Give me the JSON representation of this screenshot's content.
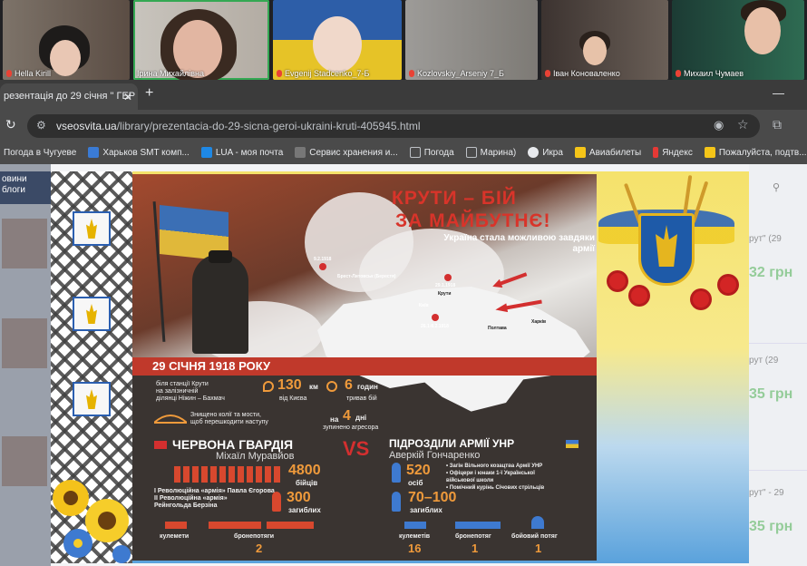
{
  "call": {
    "participants": [
      {
        "name": "Hella Kirill"
      },
      {
        "name": "Ірина Михайлівна"
      },
      {
        "name": "Evgenij Stadcenko_7-Б"
      },
      {
        "name": "Kozlovskiy_Arseniy 7_Б"
      },
      {
        "name": "Іван Коноваленко"
      },
      {
        "name": "Михаил Чумаев"
      }
    ]
  },
  "browser": {
    "tab_title": "резентація до 29 січня \" ГЕР",
    "url_host": "vseosvita.ua",
    "url_path": "/library/prezentacia-do-29-sicna-geroi-ukraini-kruti-405945.html",
    "bookmarks": [
      {
        "label": "Погода в Чугуеве",
        "icon": "weather-icon",
        "color": "#4a90e2"
      },
      {
        "label": "Харьков SMT комп...",
        "icon": "smt-icon",
        "color": "#3a7bd5"
      },
      {
        "label": "LUA - моя почта",
        "icon": "mail-icon",
        "color": "#1e88e5"
      },
      {
        "label": "Сервис хранения и...",
        "icon": "storage-icon",
        "color": "#777777"
      },
      {
        "label": "Погода",
        "icon": "folder-icon",
        "color": "#bdc1c6"
      },
      {
        "label": "Марина)",
        "icon": "folder-icon",
        "color": "#bdc1c6"
      },
      {
        "label": "Икра",
        "icon": "globe-icon",
        "color": "#e8eaed"
      },
      {
        "label": "Авиабилеты",
        "icon": "plane-icon",
        "color": "#f5c518"
      },
      {
        "label": "Яндекс",
        "icon": "yandex-icon",
        "color": "#e53935"
      },
      {
        "label": "Пожалуйста, подтв...",
        "icon": "confirm-icon",
        "color": "#f5c518"
      }
    ]
  },
  "page": {
    "left_header": "овини\nблоги",
    "right_items": [
      {
        "title": "рут\" (29",
        "price": "32 грн"
      },
      {
        "title": "рут (29",
        "price": "35 грн"
      },
      {
        "title": "рут\" - 29",
        "price": "35 грн"
      }
    ]
  },
  "slide": {
    "title_line1": "КРУТИ – БІЙ",
    "title_line2": "ЗА МАЙБУТНЄ!",
    "subtitle": "Україна стала можливою завдяки армії",
    "map_labels": {
      "brest": "Брест-Литовськ (Берестя)",
      "date1": "9.2.1918",
      "kruty": "Крути",
      "kyiv": "Київ",
      "date2": "29.1.1918",
      "date3": "26.1-8.2.1918",
      "poltava": "Полтава",
      "kharkiv": "Харків"
    },
    "date_heading": "29 СІЧНЯ 1918 РОКУ",
    "place_text": "біля станції Крути\nна залізничній\nділянці Ніжин – Бахмач",
    "distance_num": "130",
    "distance_unit": "км",
    "distance_lbl": "від Києва",
    "hours_num": "6",
    "hours_unit": "годин",
    "hours_lbl": "тривав бій",
    "rail_text": "Знищено колії та мости,\nщоб перешкодити наступу",
    "stop_prefix": "на",
    "stop_num": "4",
    "stop_unit": "дні",
    "stop_lbl": "зупинено агресора",
    "red_title": "ЧЕРВОНА ГВАРДІЯ",
    "red_commander": "Міхаїл Муравйов",
    "vs": "VS",
    "blue_title": "ПІДРОЗДІЛИ АРМІЇ УНР",
    "blue_commander": "Аверкій Гончаренко",
    "red_fighters_num": "4800",
    "red_fighters_lbl": "бійців",
    "red_units": "І Революційна «армія» Павла Єгорова\nІІ Революційна «армія»\nРейнгольда Берзіна",
    "red_dead_num": "300",
    "red_dead_lbl": "загиблих",
    "blue_fighters_num": "520",
    "blue_fighters_lbl": "осіб",
    "blue_units": "• Загін Вільного козацтва Армії УНР\n• Офіцери і юнаки 1-ї Української\n  військової школи\n• Помічний курінь Січових стрільців",
    "blue_dead_num": "70–100",
    "blue_dead_lbl": "загиблих",
    "red_mg_lbl": "кулемети",
    "red_train_lbl": "бронепотяги",
    "red_train_num": "2",
    "blue_mg_lbl": "кулеметів",
    "blue_mg_num": "16",
    "blue_train_lbl": "бронепотяг",
    "blue_train_num": "1",
    "blue_battle_lbl": "бойовий потяг",
    "blue_battle_num": "1"
  }
}
